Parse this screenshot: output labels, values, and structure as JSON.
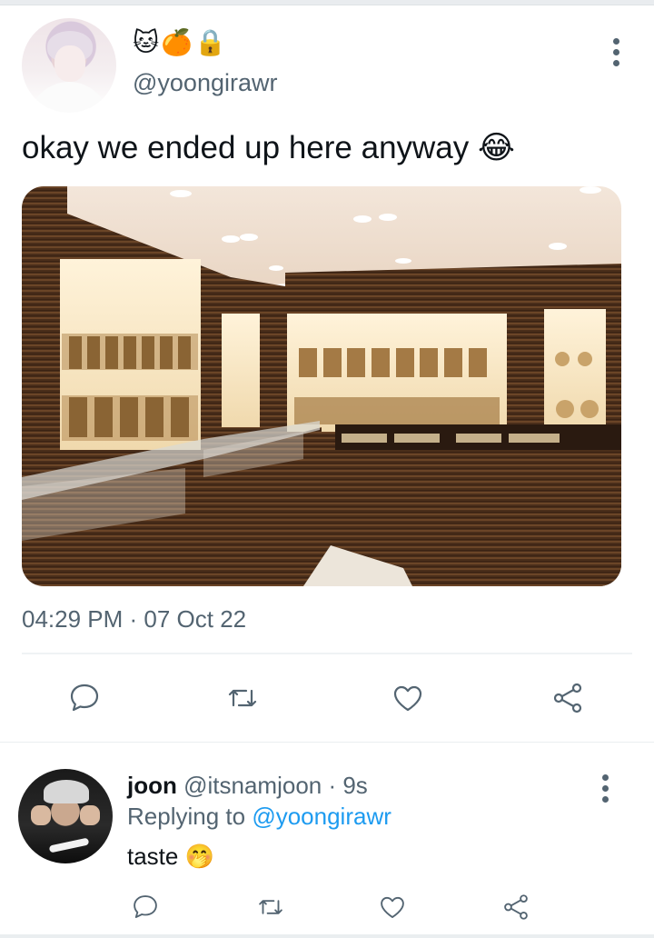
{
  "tweet": {
    "emoji_name": "🐱🍊🔒",
    "handle": "@yoongirawr",
    "text": "okay we ended up here anyway 😂",
    "timestamp": "04:29 PM · 07 Oct 22"
  },
  "reply": {
    "name": "joon",
    "meta": "@itsnamjoon · 9s",
    "replying_label": "Replying to",
    "replying_handle": "@yoongirawr",
    "text": "taste 🤭"
  },
  "icons": [
    "comment-icon",
    "retweet-icon",
    "like-icon",
    "share-icon",
    "more-icon"
  ],
  "colors": {
    "text": "#0f1419",
    "secondary": "#536471",
    "link": "#1d9bf0",
    "divider": "#eff3f4"
  }
}
